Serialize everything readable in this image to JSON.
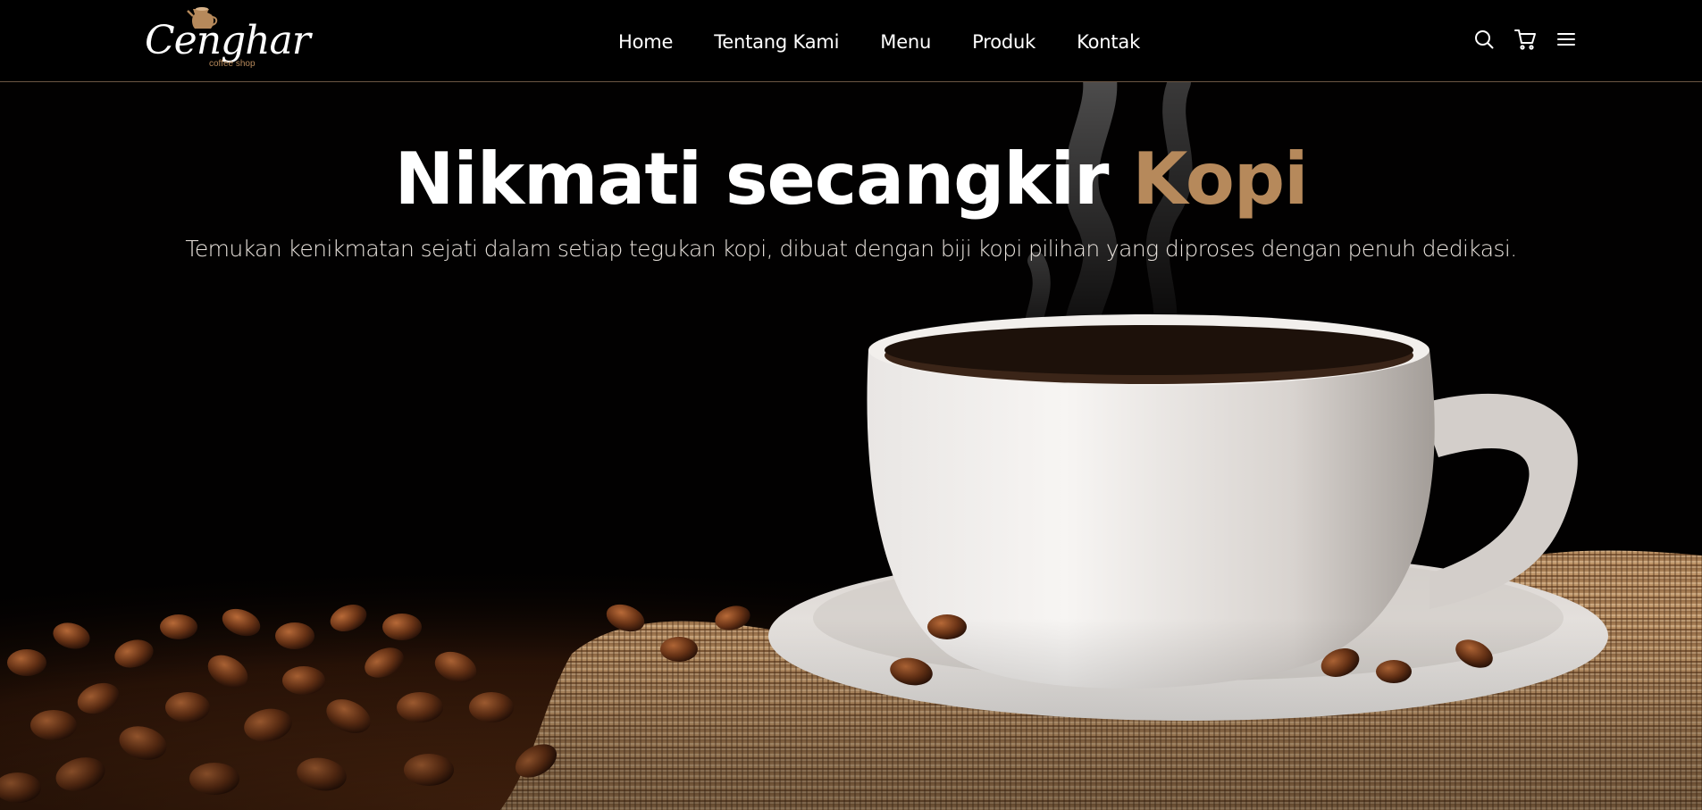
{
  "brand": {
    "name": "Cenghar",
    "tagline": "coffee shop",
    "accent_color": "#b6895b"
  },
  "nav": {
    "links": [
      "Home",
      "Tentang Kami",
      "Menu",
      "Produk",
      "Kontak"
    ],
    "icons": [
      "search-icon",
      "cart-icon",
      "menu-icon"
    ]
  },
  "hero": {
    "title_main": "Nikmati secangkir",
    "title_accent": "Kopi",
    "subtitle": "Temukan kenikmatan sejati dalam setiap tegukan kopi, dibuat dengan biji kopi pilihan yang diproses dengan penuh dedikasi."
  }
}
